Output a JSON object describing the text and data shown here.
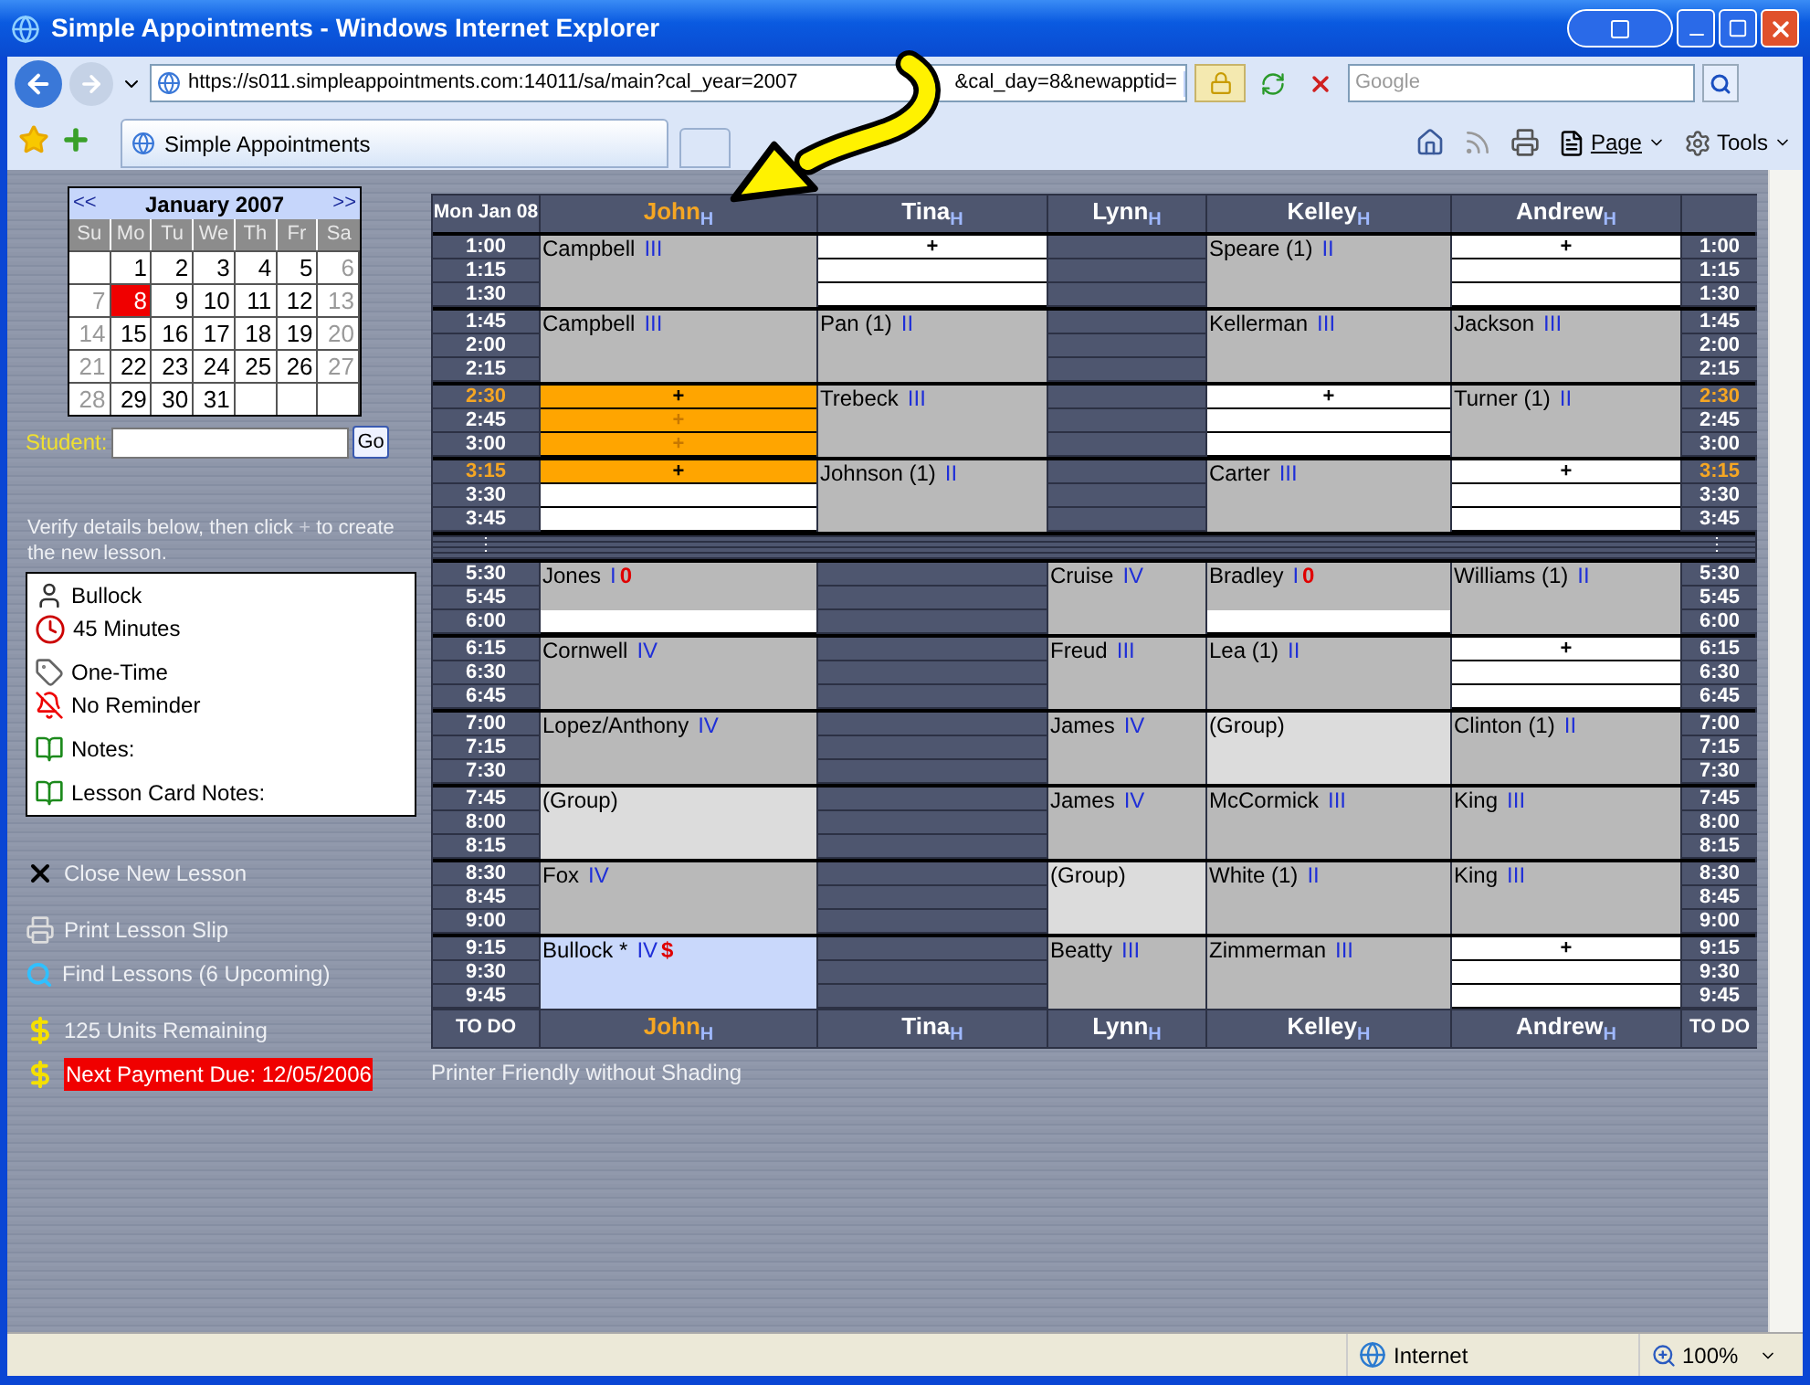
{
  "window": {
    "title": "Simple Appointments - Windows Internet Explorer"
  },
  "address_bar": {
    "url_start": "https://s011.simpleappointments.com:14011/sa/main?cal_year=2007",
    "url_end": "&cal_day=8&newapptid=",
    "search_placeholder": "Google"
  },
  "tab": {
    "label": "Simple Appointments"
  },
  "toolbar": [
    "Page",
    "Tools"
  ],
  "calendar": {
    "prev": "<<",
    "title": "January 2007",
    "next": ">>",
    "day_names": [
      "Su",
      "Mo",
      "Tu",
      "We",
      "Th",
      "Fr",
      "Sa"
    ],
    "weeks": [
      [
        {
          "kind": "blank"
        },
        {
          "kind": "day",
          "text": "1",
          "muted": false,
          "selected": false
        },
        {
          "kind": "day",
          "text": "2",
          "muted": false,
          "selected": false
        },
        {
          "kind": "day",
          "text": "3",
          "muted": false,
          "selected": false
        },
        {
          "kind": "day",
          "text": "4",
          "muted": false,
          "selected": false
        },
        {
          "kind": "day",
          "text": "5",
          "muted": false,
          "selected": false
        },
        {
          "kind": "day",
          "text": "6",
          "muted": true,
          "selected": false
        }
      ],
      [
        {
          "kind": "day",
          "text": "7",
          "muted": true,
          "selected": false
        },
        {
          "kind": "day",
          "text": "8",
          "muted": false,
          "selected": true
        },
        {
          "kind": "day",
          "text": "9",
          "muted": false,
          "selected": false
        },
        {
          "kind": "day",
          "text": "10",
          "muted": false,
          "selected": false
        },
        {
          "kind": "day",
          "text": "11",
          "muted": false,
          "selected": false
        },
        {
          "kind": "day",
          "text": "12",
          "muted": false,
          "selected": false
        },
        {
          "kind": "day",
          "text": "13",
          "muted": true,
          "selected": false
        }
      ],
      [
        {
          "kind": "day",
          "text": "14",
          "muted": true,
          "selected": false
        },
        {
          "kind": "day",
          "text": "15",
          "muted": false,
          "selected": false
        },
        {
          "kind": "day",
          "text": "16",
          "muted": false,
          "selected": false
        },
        {
          "kind": "day",
          "text": "17",
          "muted": false,
          "selected": false
        },
        {
          "kind": "day",
          "text": "18",
          "muted": false,
          "selected": false
        },
        {
          "kind": "day",
          "text": "19",
          "muted": false,
          "selected": false
        },
        {
          "kind": "day",
          "text": "20",
          "muted": true,
          "selected": false
        }
      ],
      [
        {
          "kind": "day",
          "text": "21",
          "muted": true,
          "selected": false
        },
        {
          "kind": "day",
          "text": "22",
          "muted": false,
          "selected": false
        },
        {
          "kind": "day",
          "text": "23",
          "muted": false,
          "selected": false
        },
        {
          "kind": "day",
          "text": "24",
          "muted": false,
          "selected": false
        },
        {
          "kind": "day",
          "text": "25",
          "muted": false,
          "selected": false
        },
        {
          "kind": "day",
          "text": "26",
          "muted": false,
          "selected": false
        },
        {
          "kind": "day",
          "text": "27",
          "muted": true,
          "selected": false
        }
      ],
      [
        {
          "kind": "day",
          "text": "28",
          "muted": true,
          "selected": false
        },
        {
          "kind": "day",
          "text": "29",
          "muted": false,
          "selected": false
        },
        {
          "kind": "day",
          "text": "30",
          "muted": false,
          "selected": false
        },
        {
          "kind": "day",
          "text": "31",
          "muted": false,
          "selected": false
        },
        {
          "kind": "blank"
        },
        {
          "kind": "blank"
        },
        {
          "kind": "blank"
        }
      ]
    ]
  },
  "student_search": {
    "label": "Student:",
    "button": "Go"
  },
  "instruction": {
    "before": "Verify details below, then click ",
    "plus": "+",
    "after": " to create the new lesson."
  },
  "details": [
    {
      "kind": "student",
      "text": "Bullock"
    },
    {
      "kind": "duration",
      "text": "45 Minutes"
    },
    {
      "kind": "recurrence",
      "text": "One-Time"
    },
    {
      "kind": "reminder",
      "text": "No Reminder"
    },
    {
      "kind": "notes",
      "text": "Notes:"
    },
    {
      "kind": "notes",
      "text": "Lesson Card Notes:"
    }
  ],
  "actions": [
    {
      "kind": "close",
      "text": "Close New Lesson",
      "alert": false
    },
    {
      "kind": "print",
      "text": "Print Lesson Slip",
      "alert": false
    },
    {
      "kind": "find",
      "text": "Find Lessons (6 Upcoming)",
      "alert": false
    },
    {
      "kind": "money",
      "text": "125 Units Remaining",
      "alert": false
    },
    {
      "kind": "money",
      "text": "Next Payment Due: 12/05/2006",
      "alert": true
    }
  ],
  "schedule": {
    "corner": "Mon Jan 08",
    "top_headers": [
      {
        "name": "John$_{H}$",
        "selected": true
      },
      {
        "name": "Tina$_{H}$",
        "selected": false
      },
      {
        "name": "Lynn$_{H}$",
        "selected": false
      },
      {
        "name": "Kelley$_{H}$",
        "selected": false
      },
      {
        "name": "Andrew$_{H}$",
        "selected": false
      }
    ],
    "blocks": [
      {
        "times": [
          {
            "left": "1:00",
            "right": "1:00",
            "highlight": false
          },
          {
            "left": "1:15",
            "right": "1:15",
            "highlight": false
          },
          {
            "left": "1:30",
            "right": "1:30",
            "highlight": false
          }
        ],
        "cells": [
          {
            "kind": "lesson",
            "name": "Campbell",
            "level": "III",
            "open_last": false
          },
          {
            "kind": "slots",
            "rows": [
              {
                "mark": "+",
                "selected": false,
                "dim": false
              },
              {
                "selected": false
              },
              {
                "selected": false
              }
            ]
          },
          {
            "kind": "off"
          },
          {
            "kind": "lesson",
            "name": "Speare (1)",
            "level": "II",
            "open_last": false
          },
          {
            "kind": "slots",
            "rows": [
              {
                "mark": "+",
                "selected": false,
                "dim": false
              },
              {
                "selected": false
              },
              {
                "selected": false
              }
            ]
          }
        ]
      },
      {
        "times": [
          {
            "left": "1:45",
            "right": "1:45",
            "highlight": false
          },
          {
            "left": "2:00",
            "right": "2:00",
            "highlight": false
          },
          {
            "left": "2:15",
            "right": "2:15",
            "highlight": false
          }
        ],
        "cells": [
          {
            "kind": "lesson",
            "name": "Campbell",
            "level": "III",
            "open_last": false
          },
          {
            "kind": "lesson",
            "name": "Pan (1)",
            "level": "II",
            "open_last": false
          },
          {
            "kind": "off"
          },
          {
            "kind": "lesson",
            "name": "Kellerman",
            "level": "III",
            "open_last": false
          },
          {
            "kind": "lesson",
            "name": "Jackson",
            "level": "III",
            "open_last": false
          }
        ]
      },
      {
        "times": [
          {
            "left": "2:30",
            "right": "2:30",
            "highlight": true
          },
          {
            "left": "2:45",
            "right": "2:45",
            "highlight": false
          },
          {
            "left": "3:00",
            "right": "3:00",
            "highlight": false
          }
        ],
        "cells": [
          {
            "kind": "slots",
            "rows": [
              {
                "mark": "+",
                "selected": true,
                "dim": false
              },
              {
                "mark": "+",
                "selected": true,
                "dim": true
              },
              {
                "mark": "+",
                "selected": true,
                "dim": true
              }
            ]
          },
          {
            "kind": "lesson",
            "name": "Trebeck",
            "level": "III",
            "open_last": false
          },
          {
            "kind": "off"
          },
          {
            "kind": "slots",
            "rows": [
              {
                "mark": "+",
                "selected": false,
                "dim": false
              },
              {
                "selected": false
              },
              {
                "selected": false
              }
            ]
          },
          {
            "kind": "lesson",
            "name": "Turner (1)",
            "level": "II",
            "open_last": false
          }
        ]
      },
      {
        "times": [
          {
            "left": "3:15",
            "right": "3:15",
            "highlight": true
          },
          {
            "left": "3:30",
            "right": "3:30",
            "highlight": false
          },
          {
            "left": "3:45",
            "right": "3:45",
            "highlight": false
          }
        ],
        "cells": [
          {
            "kind": "slots",
            "rows": [
              {
                "mark": "+",
                "selected": true,
                "dim": false
              },
              {
                "selected": false
              },
              {
                "selected": false
              }
            ]
          },
          {
            "kind": "lesson",
            "name": "Johnson (1)",
            "level": "II",
            "open_last": false
          },
          {
            "kind": "off"
          },
          {
            "kind": "lesson",
            "name": "Carter",
            "level": "III",
            "open_last": false
          },
          {
            "kind": "slots",
            "rows": [
              {
                "mark": "+",
                "selected": false,
                "dim": false
              },
              {
                "selected": false
              },
              {
                "selected": false
              }
            ]
          }
        ]
      },
      {
        "gap": true,
        "left": "⋮",
        "right": "⋮"
      },
      {
        "times": [
          {
            "left": "5:30",
            "right": "5:30",
            "highlight": false
          },
          {
            "left": "5:45",
            "right": "5:45",
            "highlight": false
          },
          {
            "left": "6:00",
            "right": "6:00",
            "highlight": false
          }
        ],
        "cells": [
          {
            "kind": "lesson",
            "name": "Jones",
            "level": "I",
            "flag": "0",
            "open_last": true
          },
          {
            "kind": "off"
          },
          {
            "kind": "lesson",
            "name": "Cruise",
            "level": "IV",
            "open_last": false
          },
          {
            "kind": "lesson",
            "name": "Bradley",
            "level": "I",
            "flag": "0",
            "open_last": true
          },
          {
            "kind": "lesson",
            "name": "Williams (1)",
            "level": "II",
            "open_last": false
          }
        ]
      },
      {
        "times": [
          {
            "left": "6:15",
            "right": "6:15",
            "highlight": false
          },
          {
            "left": "6:30",
            "right": "6:30",
            "highlight": false
          },
          {
            "left": "6:45",
            "right": "6:45",
            "highlight": false
          }
        ],
        "cells": [
          {
            "kind": "lesson",
            "name": "Cornwell",
            "level": "IV",
            "open_last": false
          },
          {
            "kind": "off"
          },
          {
            "kind": "lesson",
            "name": "Freud",
            "level": "III",
            "open_last": false
          },
          {
            "kind": "lesson",
            "name": "Lea (1)",
            "level": "II",
            "open_last": false
          },
          {
            "kind": "slots",
            "rows": [
              {
                "mark": "+",
                "selected": false,
                "dim": false
              },
              {
                "selected": false
              },
              {
                "selected": false
              }
            ]
          }
        ]
      },
      {
        "times": [
          {
            "left": "7:00",
            "right": "7:00",
            "highlight": false
          },
          {
            "left": "7:15",
            "right": "7:15",
            "highlight": false
          },
          {
            "left": "7:30",
            "right": "7:30",
            "highlight": false
          }
        ],
        "cells": [
          {
            "kind": "lesson",
            "name": "Lopez/Anthony",
            "level": "IV",
            "open_last": false
          },
          {
            "kind": "off"
          },
          {
            "kind": "lesson",
            "name": "James",
            "level": "IV",
            "open_last": false
          },
          {
            "kind": "group",
            "name": "(Group)",
            "open_last": false
          },
          {
            "kind": "lesson",
            "name": "Clinton (1)",
            "level": "II",
            "open_last": false
          }
        ]
      },
      {
        "times": [
          {
            "left": "7:45",
            "right": "7:45",
            "highlight": false
          },
          {
            "left": "8:00",
            "right": "8:00",
            "highlight": false
          },
          {
            "left": "8:15",
            "right": "8:15",
            "highlight": false
          }
        ],
        "cells": [
          {
            "kind": "group",
            "name": "(Group)",
            "open_last": false
          },
          {
            "kind": "off"
          },
          {
            "kind": "lesson",
            "name": "James",
            "level": "IV",
            "open_last": false
          },
          {
            "kind": "lesson",
            "name": "McCormick",
            "level": "III",
            "open_last": false
          },
          {
            "kind": "lesson",
            "name": "King",
            "level": "III",
            "open_last": false
          }
        ]
      },
      {
        "times": [
          {
            "left": "8:30",
            "right": "8:30",
            "highlight": false
          },
          {
            "left": "8:45",
            "right": "8:45",
            "highlight": false
          },
          {
            "left": "9:00",
            "right": "9:00",
            "highlight": false
          }
        ],
        "cells": [
          {
            "kind": "lesson",
            "name": "Fox",
            "level": "IV",
            "open_last": false
          },
          {
            "kind": "off"
          },
          {
            "kind": "group",
            "name": "(Group)",
            "open_last": false
          },
          {
            "kind": "lesson",
            "name": "White (1)",
            "level": "II",
            "open_last": false
          },
          {
            "kind": "lesson",
            "name": "King",
            "level": "III",
            "open_last": false
          }
        ]
      },
      {
        "times": [
          {
            "left": "9:15",
            "right": "9:15",
            "highlight": false
          },
          {
            "left": "9:30",
            "right": "9:30",
            "highlight": false
          },
          {
            "left": "9:45",
            "right": "9:45",
            "highlight": false
          }
        ],
        "cells": [
          {
            "kind": "current",
            "name": "Bullock *",
            "level": "IV",
            "flag": "$",
            "open_last": false
          },
          {
            "kind": "off"
          },
          {
            "kind": "lesson",
            "name": "Beatty",
            "level": "III",
            "open_last": false
          },
          {
            "kind": "lesson",
            "name": "Zimmerman",
            "level": "III",
            "open_last": false
          },
          {
            "kind": "slots",
            "rows": [
              {
                "mark": "+",
                "selected": false,
                "dim": false
              },
              {
                "selected": false
              },
              {
                "selected": false
              }
            ]
          }
        ]
      }
    ],
    "bottom_left": "TO DO",
    "bottom_headers": [
      {
        "name": "John$_{H}$",
        "selected": true
      },
      {
        "name": "Tina$_{H}$",
        "selected": false
      },
      {
        "name": "Lynn$_{H}$",
        "selected": false
      },
      {
        "name": "Kelley$_{H}$",
        "selected": false
      },
      {
        "name": "Andrew$_{H}$",
        "selected": false
      }
    ],
    "bottom_right": "TO DO"
  },
  "printer_link": "Printer Friendly without Shading",
  "status_bar": {
    "zone": "Internet",
    "zoom": "100%"
  }
}
